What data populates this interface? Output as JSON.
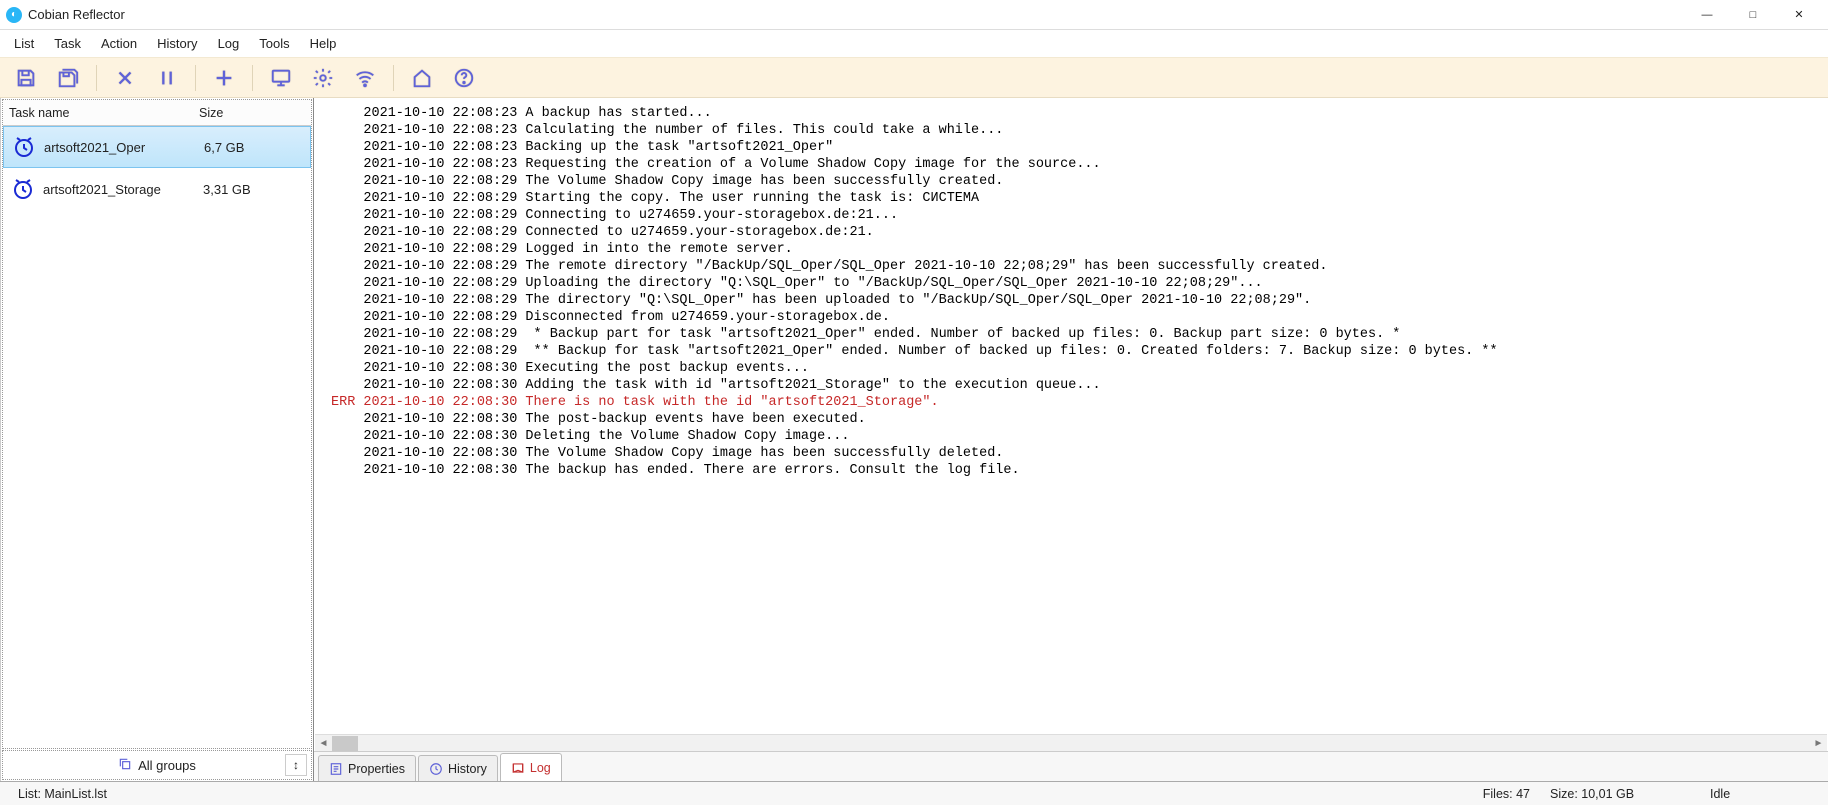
{
  "window": {
    "title": "Cobian Reflector"
  },
  "menu": {
    "items": [
      "List",
      "Task",
      "Action",
      "History",
      "Log",
      "Tools",
      "Help"
    ]
  },
  "toolbar": {
    "icons": [
      "save-one-icon",
      "save-all-icon",
      "_sep",
      "delete-icon",
      "pause-icon",
      "_sep",
      "add-icon",
      "_sep",
      "monitor-icon",
      "gear-icon",
      "wifi-icon",
      "_sep",
      "home-icon",
      "help-icon"
    ]
  },
  "tasklist": {
    "columns": {
      "name": "Task name",
      "size": "Size"
    },
    "rows": [
      {
        "name": "artsoft2021_Oper",
        "size": "6,7 GB",
        "selected": true
      },
      {
        "name": "artsoft2021_Storage",
        "size": "3,31 GB",
        "selected": false
      }
    ]
  },
  "allgroups_label": "All groups",
  "log": {
    "lines": [
      {
        "t": "    2021-10-10 22:08:23 A backup has started..."
      },
      {
        "t": "    2021-10-10 22:08:23 Calculating the number of files. This could take a while..."
      },
      {
        "t": "    2021-10-10 22:08:23 Backing up the task \"artsoft2021_Oper\""
      },
      {
        "t": "    2021-10-10 22:08:23 Requesting the creation of a Volume Shadow Copy image for the source..."
      },
      {
        "t": "    2021-10-10 22:08:29 The Volume Shadow Copy image has been successfully created."
      },
      {
        "t": "    2021-10-10 22:08:29 Starting the copy. The user running the task is: СИСТЕМА"
      },
      {
        "t": "    2021-10-10 22:08:29 Connecting to u274659.your-storagebox.de:21..."
      },
      {
        "t": "    2021-10-10 22:08:29 Connected to u274659.your-storagebox.de:21."
      },
      {
        "t": "    2021-10-10 22:08:29 Logged in into the remote server."
      },
      {
        "t": "    2021-10-10 22:08:29 The remote directory \"/BackUp/SQL_Oper/SQL_Oper 2021-10-10 22;08;29\" has been successfully created."
      },
      {
        "t": "    2021-10-10 22:08:29 Uploading the directory \"Q:\\SQL_Oper\" to \"/BackUp/SQL_Oper/SQL_Oper 2021-10-10 22;08;29\"..."
      },
      {
        "t": "    2021-10-10 22:08:29 The directory \"Q:\\SQL_Oper\" has been uploaded to \"/BackUp/SQL_Oper/SQL_Oper 2021-10-10 22;08;29\"."
      },
      {
        "t": "    2021-10-10 22:08:29 Disconnected from u274659.your-storagebox.de."
      },
      {
        "t": "    2021-10-10 22:08:29  * Backup part for task \"artsoft2021_Oper\" ended. Number of backed up files: 0. Backup part size: 0 bytes. *"
      },
      {
        "t": "    2021-10-10 22:08:29  ** Backup for task \"artsoft2021_Oper\" ended. Number of backed up files: 0. Created folders: 7. Backup size: 0 bytes. **"
      },
      {
        "t": "    2021-10-10 22:08:30 Executing the post backup events..."
      },
      {
        "t": "    2021-10-10 22:08:30 Adding the task with id \"artsoft2021_Storage\" to the execution queue..."
      },
      {
        "t": "ERR 2021-10-10 22:08:30 There is no task with the id \"artsoft2021_Storage\".",
        "err": true
      },
      {
        "t": "    2021-10-10 22:08:30 The post-backup events have been executed."
      },
      {
        "t": "    2021-10-10 22:08:30 Deleting the Volume Shadow Copy image..."
      },
      {
        "t": "    2021-10-10 22:08:30 The Volume Shadow Copy image has been successfully deleted."
      },
      {
        "t": "    2021-10-10 22:08:30 The backup has ended. There are errors. Consult the log file."
      }
    ]
  },
  "tabs": {
    "properties": "Properties",
    "history": "History",
    "log": "Log",
    "active": "log"
  },
  "status": {
    "list": "List: MainList.lst",
    "files": "Files: 47",
    "size": "Size: 10,01 GB",
    "state": "Idle"
  }
}
